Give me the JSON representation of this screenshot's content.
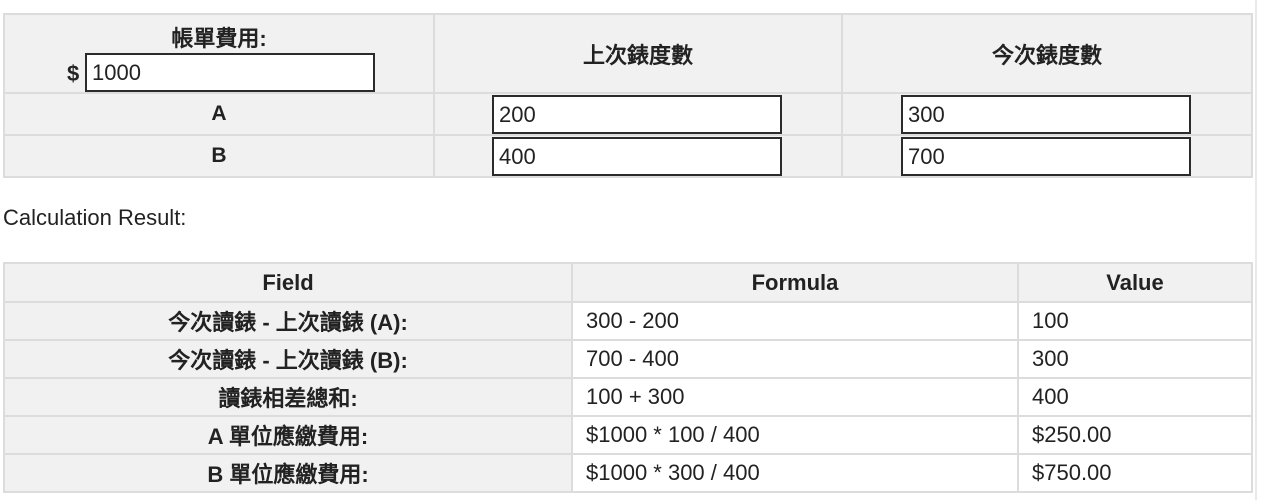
{
  "input_table": {
    "bill_label": "帳單費用:",
    "currency_symbol": "$",
    "bill_amount": "1000",
    "last_reading_header": "上次錶度數",
    "current_reading_header": "今次錶度數",
    "rows": [
      {
        "label": "A",
        "last": "200",
        "current": "300"
      },
      {
        "label": "B",
        "last": "400",
        "current": "700"
      }
    ]
  },
  "result_label": "Calculation Result:",
  "result_table": {
    "headers": [
      "Field",
      "Formula",
      "Value"
    ],
    "rows": [
      {
        "field": "今次讀錶 - 上次讀錶 (A):",
        "formula": "300 - 200",
        "value": "100"
      },
      {
        "field": "今次讀錶 - 上次讀錶 (B):",
        "formula": "700 - 400",
        "value": "300"
      },
      {
        "field": "讀錶相差總和:",
        "formula": "100 + 300",
        "value": "400"
      },
      {
        "field": "A 單位應繳費用:",
        "formula": "$1000 * 100 / 400",
        "value": "$250.00"
      },
      {
        "field": "B 單位應繳費用:",
        "formula": "$1000 * 300 / 400",
        "value": "$750.00"
      }
    ]
  }
}
